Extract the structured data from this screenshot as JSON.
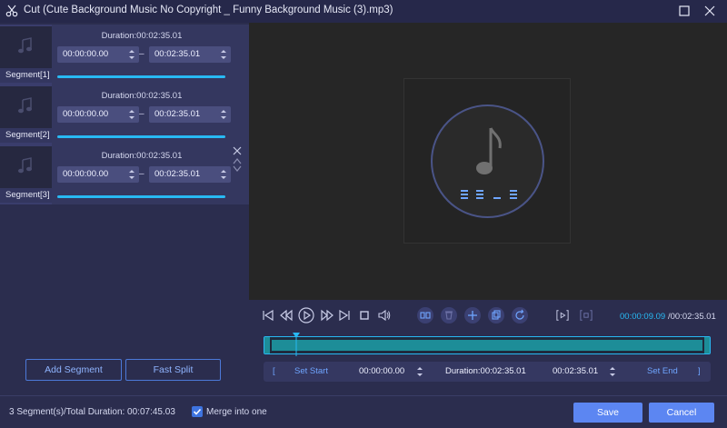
{
  "window": {
    "title": "Cut (Cute Background Music No Copyright _ Funny Background Music (3).mp3)",
    "icons": [
      "scissors-icon",
      "maximize-icon",
      "close-icon"
    ]
  },
  "segments": [
    {
      "label": "Segment[1]",
      "duration": "Duration:00:02:35.01",
      "start": "00:00:00.00",
      "end": "00:02:35.01"
    },
    {
      "label": "Segment[2]",
      "duration": "Duration:00:02:35.01",
      "start": "00:00:00.00",
      "end": "00:02:35.01"
    },
    {
      "label": "Segment[3]",
      "duration": "Duration:00:02:35.01",
      "start": "00:00:00.00",
      "end": "00:02:35.01"
    }
  ],
  "separator": "–",
  "left_buttons": {
    "add_segment": "Add Segment",
    "fast_split": "Fast Split"
  },
  "player": {
    "time_current": "00:00:09.09",
    "time_total": "/00:02:35.01",
    "icons": [
      "skip-start-icon",
      "rewind-icon",
      "play-icon",
      "fast-forward-icon",
      "skip-end-icon",
      "stop-icon",
      "volume-icon",
      "split-icon",
      "delete-icon",
      "add-icon",
      "copy-icon",
      "reset-icon",
      "play-segment-icon",
      "stop-segment-icon"
    ]
  },
  "trim_bar": {
    "open_bracket": "[",
    "set_start": "Set Start",
    "start_time": "00:00:00.00",
    "duration": "Duration:00:02:35.01",
    "end_time": "00:02:35.01",
    "set_end": "Set End",
    "close_bracket": "]"
  },
  "footer": {
    "summary": "3 Segment(s)/Total Duration: 00:07:45.03",
    "merge_label": "Merge into one",
    "merge_checked": true,
    "save": "Save",
    "cancel": "Cancel"
  },
  "colors": {
    "accent": "#28b9f3",
    "button": "#5c86f2",
    "panel": "#2b2d4e"
  }
}
